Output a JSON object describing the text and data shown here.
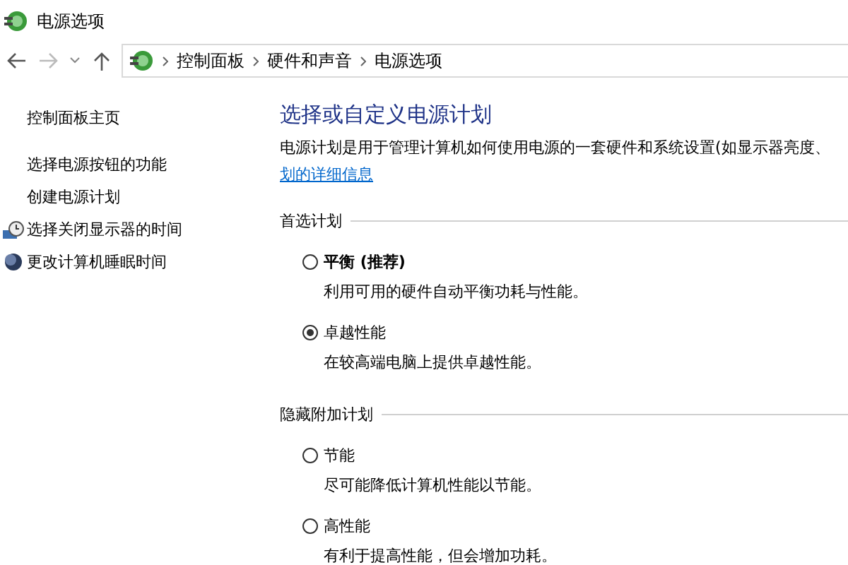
{
  "window": {
    "title": "电源选项"
  },
  "address_bar": {
    "crumbs": [
      "控制面板",
      "硬件和声音",
      "电源选项"
    ]
  },
  "sidebar": {
    "home": "控制面板主页",
    "items": [
      {
        "label": "选择电源按钮的功能",
        "kind": "plain"
      },
      {
        "label": "创建电源计划",
        "kind": "plain"
      },
      {
        "label": "选择关闭显示器的时间",
        "kind": "monitor"
      },
      {
        "label": "更改计算机睡眠时间",
        "kind": "moon"
      }
    ]
  },
  "main": {
    "heading": "选择或自定义电源计划",
    "description": "电源计划是用于管理计算机如何使用电源的一套硬件和系统设置(如显示器亮度、",
    "link": "划的详细信息",
    "groups": [
      {
        "title": "首选计划",
        "plans": [
          {
            "name": "平衡 (推荐)",
            "description": "利用可用的硬件自动平衡功耗与性能。",
            "selected": false
          },
          {
            "name": "卓越性能",
            "description": "在较高端电脑上提供卓越性能。",
            "selected": true
          }
        ]
      },
      {
        "title": "隐藏附加计划",
        "plans": [
          {
            "name": "节能",
            "description": "尽可能降低计算机性能以节能。",
            "selected": false
          },
          {
            "name": "高性能",
            "description": "有利于提高性能，但会增加功耗。",
            "selected": false
          }
        ]
      }
    ]
  }
}
